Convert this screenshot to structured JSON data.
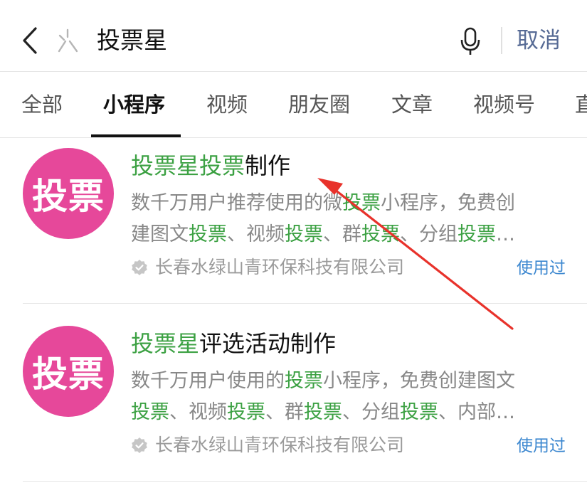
{
  "search": {
    "query": "投票星",
    "cancel_label": "取消"
  },
  "tabs": [
    {
      "label": "全部"
    },
    {
      "label": "小程序"
    },
    {
      "label": "视频"
    },
    {
      "label": "朋友圈"
    },
    {
      "label": "文章"
    },
    {
      "label": "视频号"
    },
    {
      "label": "直"
    }
  ],
  "results": [
    {
      "avatar_text": "投票",
      "title": [
        {
          "text": "投票星投票",
          "highlight": true
        },
        {
          "text": "制作",
          "highlight": false
        }
      ],
      "desc_line1": [
        {
          "text": "数千万用户推荐使用的微",
          "highlight": false
        },
        {
          "text": "投票",
          "highlight": true
        },
        {
          "text": "小程序，免费创",
          "highlight": false
        }
      ],
      "desc_line2": [
        {
          "text": "建图文",
          "highlight": false
        },
        {
          "text": "投票",
          "highlight": true
        },
        {
          "text": "、视频",
          "highlight": false
        },
        {
          "text": "投票",
          "highlight": true
        },
        {
          "text": "、群",
          "highlight": false
        },
        {
          "text": "投票",
          "highlight": true
        },
        {
          "text": "、分组",
          "highlight": false
        },
        {
          "text": "投票",
          "highlight": true
        },
        {
          "text": "…",
          "highlight": false
        }
      ],
      "source": "长春水绿山青环保科技有限公司",
      "used_label": "使用过"
    },
    {
      "avatar_text": "投票",
      "title": [
        {
          "text": "投票星",
          "highlight": true
        },
        {
          "text": "评选活动制作",
          "highlight": false
        }
      ],
      "desc_line1": [
        {
          "text": "数千万用户使用的",
          "highlight": false
        },
        {
          "text": "投票",
          "highlight": true
        },
        {
          "text": "小程序，免费创建图文",
          "highlight": false
        }
      ],
      "desc_line2": [
        {
          "text": "投票",
          "highlight": true
        },
        {
          "text": "、视频",
          "highlight": false
        },
        {
          "text": "投票",
          "highlight": true
        },
        {
          "text": "、群",
          "highlight": false
        },
        {
          "text": "投票",
          "highlight": true
        },
        {
          "text": "、分组",
          "highlight": false
        },
        {
          "text": "投票",
          "highlight": true
        },
        {
          "text": "、内部…",
          "highlight": false
        }
      ],
      "source": "长春水绿山青环保科技有限公司",
      "used_label": "使用过"
    }
  ],
  "colors": {
    "highlight": "#3ca143",
    "avatar_bg": "#e6489a",
    "link_blue": "#576b95",
    "used_blue": "#3d88d0",
    "annotation_arrow": "#e8322b"
  }
}
